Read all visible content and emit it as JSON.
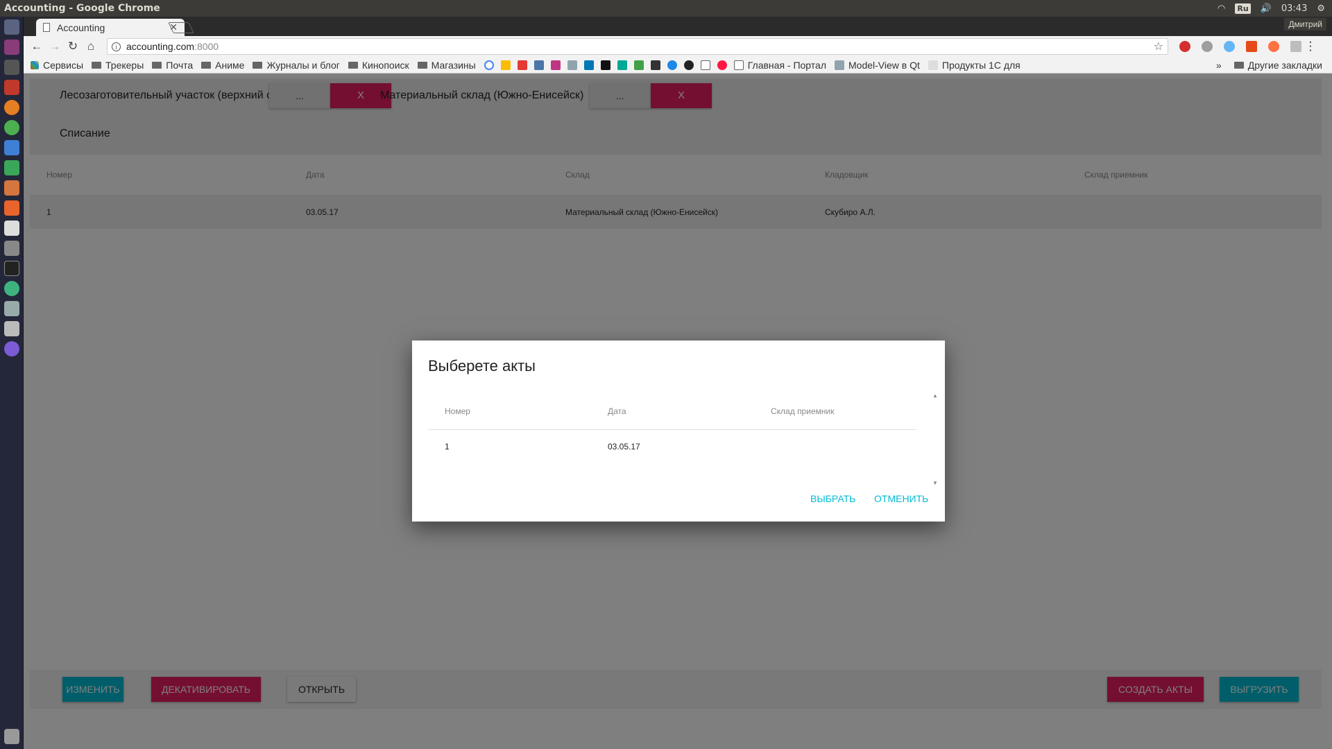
{
  "system": {
    "window_title": "Accounting - Google Chrome",
    "keyboard_layout": "Ru",
    "time": "03:43",
    "user": "Дмитрий"
  },
  "browser": {
    "tab_title": "Accounting",
    "url_host": "accounting.com",
    "url_port": ":8000",
    "bookmarks": [
      {
        "label": "Сервисы",
        "icon": "apps-grid-icon"
      },
      {
        "label": "Трекеры",
        "icon": "folder-icon"
      },
      {
        "label": "Почта",
        "icon": "folder-icon"
      },
      {
        "label": "Аниме",
        "icon": "folder-icon"
      },
      {
        "label": "Журналы и блог",
        "icon": "folder-icon"
      },
      {
        "label": "Кинопоиск",
        "icon": "folder-icon"
      },
      {
        "label": "Магазины",
        "icon": "folder-icon"
      }
    ],
    "bookmarks_tail": [
      {
        "label": "Главная - Портал",
        "icon": "page-icon"
      },
      {
        "label": "Model-View в Qt",
        "icon": "h-icon"
      },
      {
        "label": "Продукты 1С для",
        "icon": "feather-icon"
      }
    ],
    "other_bookmarks": "Другие закладки",
    "overflow": "»"
  },
  "filters": {
    "source_label": "Лесозаготовительный участок (верхний склад",
    "source_pick": "...",
    "source_clear": "X",
    "target_label": "Материальный склад (Южно-Енисейск)",
    "target_pick": "...",
    "target_clear": "X",
    "operation": "Списание"
  },
  "table": {
    "columns": [
      "Номер",
      "Дата",
      "Склад",
      "Кладовщик",
      "Склад приемник"
    ],
    "rows": [
      [
        "1",
        "03.05.17",
        "Материальный склад (Южно-Енисейск)",
        "Скубиро А.Л.",
        ""
      ]
    ]
  },
  "footer": {
    "edit": "ИЗМЕНИТЬ",
    "deactivate": "ДЕКАТИВИРОВАТЬ",
    "open": "ОТКРЫТЬ",
    "create_acts": "СОЗДАТЬ АКТЫ",
    "export": "ВЫГРУЗИТЬ"
  },
  "dialog": {
    "title": "Выберете акты",
    "columns": [
      "Номер",
      "Дата",
      "Склад приемник"
    ],
    "rows": [
      [
        "1",
        "03.05.17",
        ""
      ]
    ],
    "select": "ВЫБРАТЬ",
    "cancel": "ОТМЕНИТЬ"
  },
  "colors": {
    "accent_teal": "#00bcd4",
    "accent_pink": "#e91e63"
  }
}
